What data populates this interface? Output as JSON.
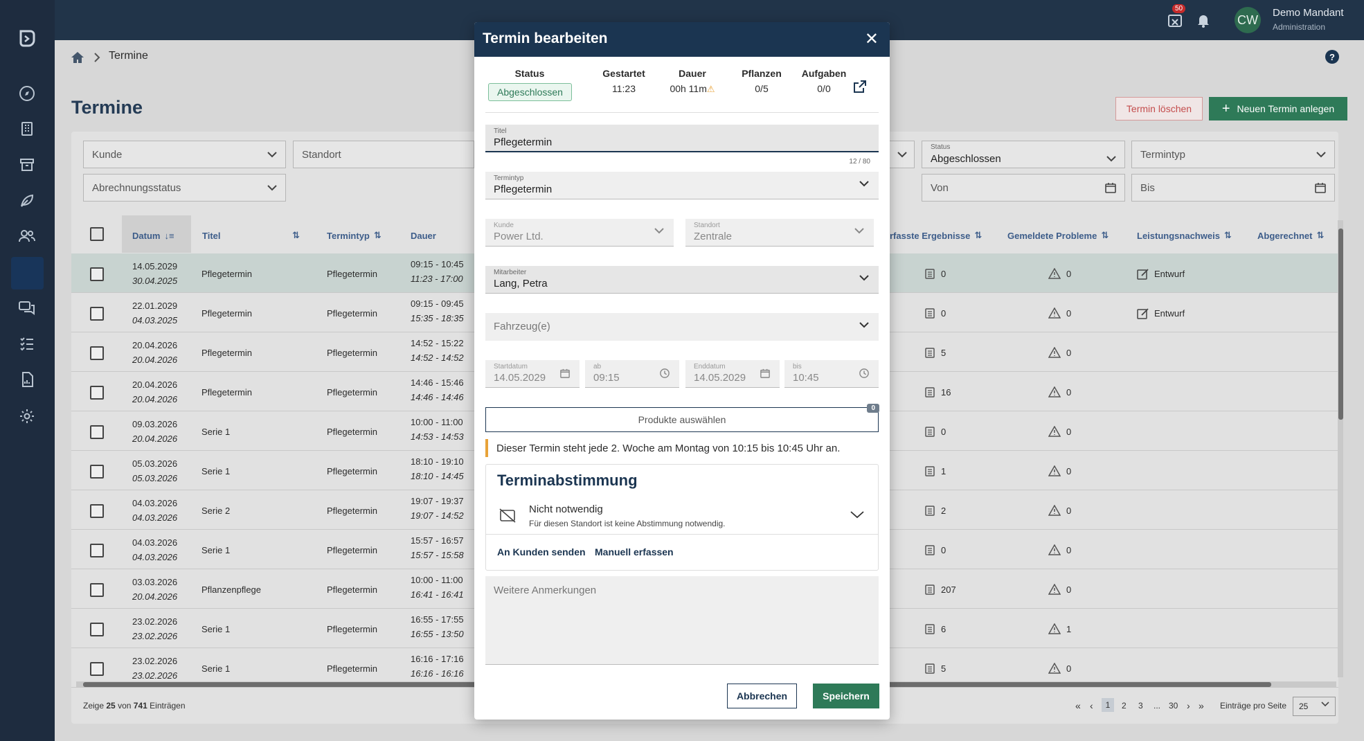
{
  "app": {
    "notifications_count": "50",
    "avatar_initials": "CW",
    "user_name": "Demo Mandant",
    "user_role": "Administration"
  },
  "breadcrumb": {
    "current": "Termine"
  },
  "page": {
    "title": "Termine",
    "delete_label": "Termin löschen",
    "new_label": "Neuen Termin anlegen"
  },
  "filters": {
    "kunde": "Kunde",
    "standort": "Standort",
    "abrechnungsstatus": "Abrechnungsstatus",
    "status_label": "Status",
    "status_value": "Abgeschlossen",
    "termintyp": "Termintyp",
    "von": "Von",
    "bis": "Bis"
  },
  "table": {
    "headers": {
      "datum": "Datum",
      "titel": "Titel",
      "termintyp": "Termintyp",
      "dauer": "Dauer",
      "ergebnisse": "rfasste Ergebnisse",
      "probleme": "Gemeldete Probleme",
      "leistungsnachweis": "Leistungsnachweis",
      "abgerechnet": "Abgerechnet"
    },
    "rows": [
      {
        "d1": "14.05.2029",
        "d2": "30.04.2025",
        "titel": "Pflegetermin",
        "typ": "Pflegetermin",
        "t1": "09:15 - 10:45",
        "t2": "11:23 - 17:00",
        "erg": "0",
        "prob": "0",
        "nachweis": "Entwurf"
      },
      {
        "d1": "22.01.2029",
        "d2": "04.03.2025",
        "titel": "Pflegetermin",
        "typ": "Pflegetermin",
        "t1": "09:15 - 09:45",
        "t2": "15:35 - 18:35",
        "erg": "0",
        "prob": "0",
        "nachweis": "Entwurf"
      },
      {
        "d1": "20.04.2026",
        "d2": "20.04.2026",
        "titel": "Pflegetermin",
        "typ": "Pflegetermin",
        "t1": "14:52 - 15:22",
        "t2": "14:52 - 14:52",
        "erg": "5",
        "prob": "0",
        "nachweis": ""
      },
      {
        "d1": "20.04.2026",
        "d2": "20.04.2026",
        "titel": "Pflegetermin",
        "typ": "Pflegetermin",
        "t1": "14:46 - 15:46",
        "t2": "14:46 - 14:46",
        "erg": "16",
        "prob": "0",
        "nachweis": ""
      },
      {
        "d1": "09.03.2026",
        "d2": "20.04.2026",
        "titel": "Serie 1",
        "typ": "Pflegetermin",
        "t1": "10:00 - 11:00",
        "t2": "14:53 - 14:53",
        "erg": "0",
        "prob": "0",
        "nachweis": ""
      },
      {
        "d1": "05.03.2026",
        "d2": "05.03.2026",
        "titel": "Serie 1",
        "typ": "Pflegetermin",
        "t1": "18:10 - 19:10",
        "t2": "18:10 - 14:45",
        "erg": "1",
        "prob": "0",
        "nachweis": ""
      },
      {
        "d1": "04.03.2026",
        "d2": "04.03.2026",
        "titel": "Serie 2",
        "typ": "Pflegetermin",
        "t1": "19:07 - 19:37",
        "t2": "19:07 - 14:52",
        "erg": "2",
        "prob": "0",
        "nachweis": ""
      },
      {
        "d1": "04.03.2026",
        "d2": "04.03.2026",
        "titel": "Serie 1",
        "typ": "Pflegetermin",
        "t1": "15:57 - 16:57",
        "t2": "15:57 - 15:58",
        "erg": "0",
        "prob": "0",
        "nachweis": ""
      },
      {
        "d1": "03.03.2026",
        "d2": "20.04.2026",
        "titel": "Pflanzenpflege",
        "typ": "Pflegetermin",
        "t1": "10:00 - 11:00",
        "t2": "16:41 - 16:41",
        "erg": "207",
        "prob": "0",
        "nachweis": ""
      },
      {
        "d1": "23.02.2026",
        "d2": "23.02.2026",
        "titel": "Serie 1",
        "typ": "Pflegetermin",
        "t1": "16:55 - 17:55",
        "t2": "16:55 - 13:50",
        "erg": "6",
        "prob": "1",
        "nachweis": ""
      },
      {
        "d1": "23.02.2026",
        "d2": "23.02.2026",
        "titel": "Serie 1",
        "typ": "Pflegetermin",
        "t1": "16:16 - 17:16",
        "t2": "16:16 - 16:16",
        "erg": "5",
        "prob": "0",
        "nachweis": ""
      }
    ]
  },
  "footer": {
    "showing_prefix": "Zeige",
    "showing_count": "25",
    "showing_mid": "von",
    "showing_total": "741",
    "showing_suffix": "Einträgen",
    "pages": [
      "1",
      "2",
      "3",
      "...",
      "30"
    ],
    "per_page_label": "Einträge pro Seite",
    "per_page_value": "25"
  },
  "modal": {
    "title": "Termin bearbeiten",
    "status_h": "Status",
    "status_v": "Abgeschlossen",
    "gestartet_h": "Gestartet",
    "gestartet_v": "11:23",
    "dauer_h": "Dauer",
    "dauer_v": "00h 11m",
    "pflanzen_h": "Pflanzen",
    "pflanzen_v": "0/5",
    "aufgaben_h": "Aufgaben",
    "aufgaben_v": "0/0",
    "titel_label": "Titel",
    "titel_value": "Pflegetermin",
    "titel_counter": "12 / 80",
    "termintyp_label": "Termintyp",
    "termintyp_value": "Pflegetermin",
    "kunde_label": "Kunde",
    "kunde_value": "Power Ltd.",
    "standort_label": "Standort",
    "standort_value": "Zentrale",
    "mitarbeiter_label": "Mitarbeiter",
    "mitarbeiter_value": "Lang, Petra",
    "fahrzeug_placeholder": "Fahrzeug(e)",
    "startdatum_label": "Startdatum",
    "startdatum_value": "14.05.2029",
    "ab_label": "ab",
    "ab_value": "09:15",
    "enddatum_label": "Enddatum",
    "enddatum_value": "14.05.2029",
    "bis_label": "bis",
    "bis_value": "10:45",
    "produkte_label": "Produkte auswählen",
    "produkte_count": "0",
    "info_text": "Dieser Termin steht jede 2. Woche am Montag von 10:15 bis 10:45 Uhr an.",
    "abstimmung_title": "Terminabstimmung",
    "abstimmung_status": "Nicht notwendig",
    "abstimmung_desc": "Für diesen Standort ist keine Abstimmung notwendig.",
    "send_label": "An Kunden senden",
    "manual_label": "Manuell erfassen",
    "notes_placeholder": "Weitere Anmerkungen",
    "cancel_label": "Abbrechen",
    "save_label": "Speichern"
  },
  "colors": {
    "sidebar": "#1e2c3f",
    "primary": "#1b3551",
    "green": "#2e7a58",
    "warning": "#e8a339",
    "danger": "#c44d4d"
  }
}
